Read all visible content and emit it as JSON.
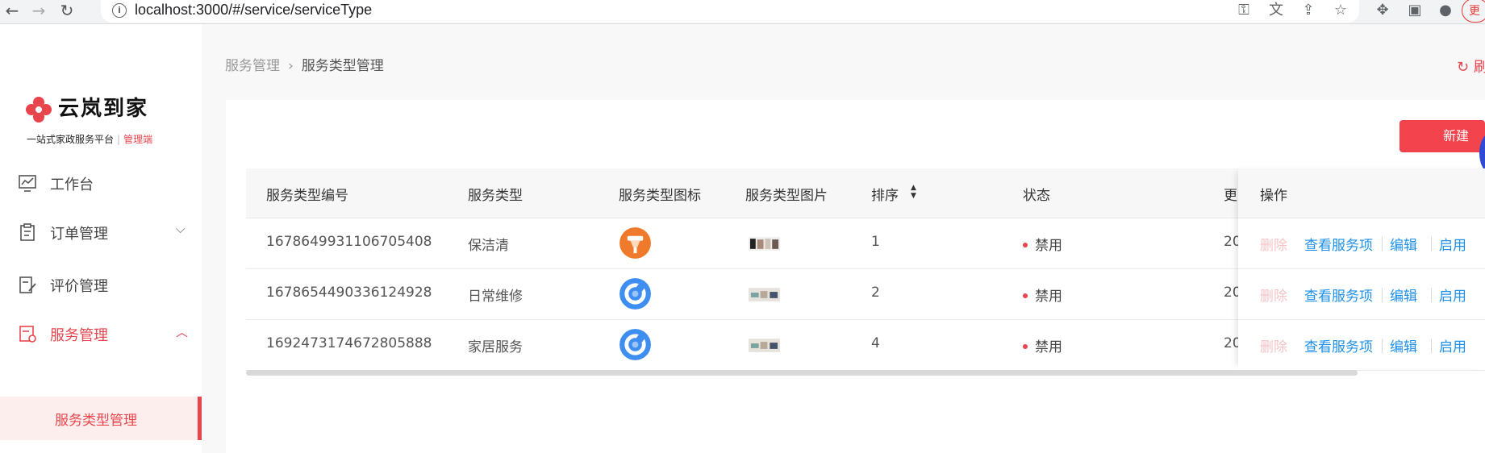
{
  "browser": {
    "url": "localhost:3000/#/service/serviceType",
    "profile_label": "更"
  },
  "sidebar": {
    "logo_title": "云岚到家",
    "logo_subtitle": "一站式家政服务平台",
    "logo_admin": "管理端",
    "items": [
      {
        "label": "工作台"
      },
      {
        "label": "订单管理"
      },
      {
        "label": "评价管理"
      },
      {
        "label": "服务管理"
      }
    ],
    "subitem": {
      "label": "服务类型管理"
    }
  },
  "header": {
    "breadcrumb_parent": "服务管理",
    "breadcrumb_current": "服务类型管理",
    "refresh_label": "刷"
  },
  "toolbar": {
    "new_label": "新建"
  },
  "table": {
    "columns": [
      "服务类型编号",
      "服务类型",
      "服务类型图标",
      "服务类型图片",
      "排序",
      "状态",
      "更",
      "操作"
    ],
    "rows": [
      {
        "id": "1678649931106705408",
        "type": "保洁清",
        "icon": "broom-icon",
        "sort": "1",
        "status": "禁用",
        "updated": "20"
      },
      {
        "id": "1678654490336124928",
        "type": "日常维修",
        "icon": "wrench-icon",
        "sort": "2",
        "status": "禁用",
        "updated": "20"
      },
      {
        "id": "1692473174672805888",
        "type": "家居服务",
        "icon": "wrench-icon",
        "sort": "4",
        "status": "禁用",
        "updated": "20"
      }
    ],
    "actions": {
      "delete": "删除",
      "view": "查看服务项",
      "edit": "编辑",
      "enable": "启用"
    }
  },
  "colors": {
    "accent": "#e8454d",
    "link": "#1e90e8",
    "button": "#f3434d"
  }
}
